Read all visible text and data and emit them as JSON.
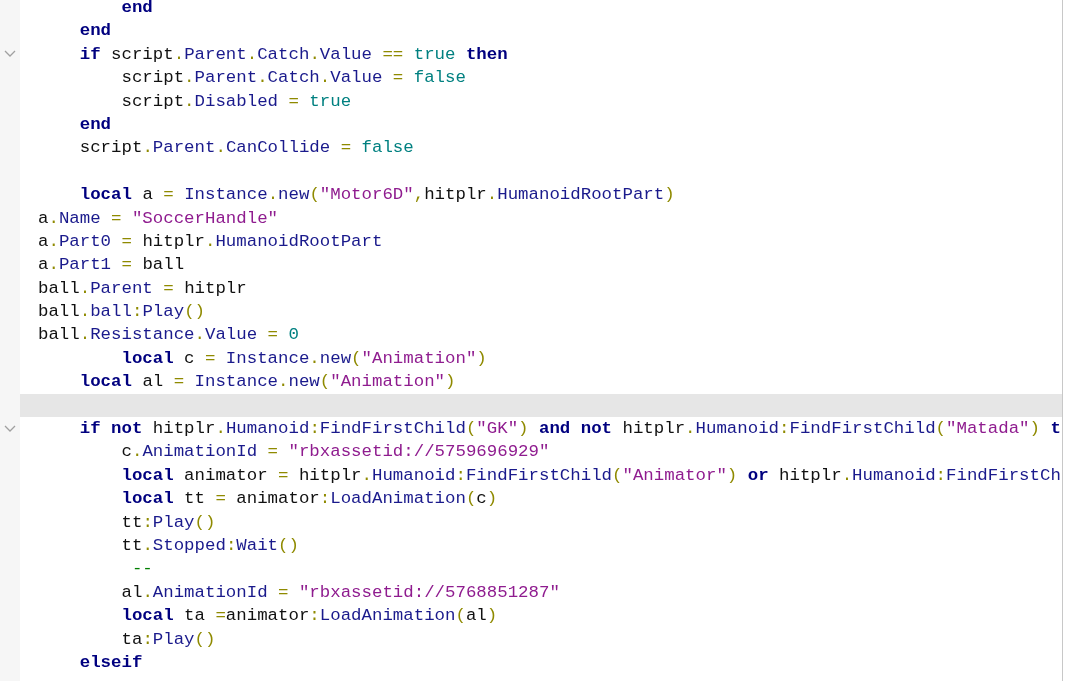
{
  "editor": {
    "lines": [
      {
        "fold_marker": false,
        "current": false,
        "tokens": [
          {
            "kind": "kw",
            "text": "        end"
          }
        ]
      },
      {
        "fold_marker": false,
        "current": false,
        "tokens": [
          {
            "kind": "kw",
            "text": "    end"
          }
        ]
      },
      {
        "fold_marker": true,
        "current": false,
        "tokens": [
          {
            "kind": "kw",
            "text": "    if "
          },
          {
            "kind": "id",
            "text": "script"
          },
          {
            "kind": "op",
            "text": "."
          },
          {
            "kind": "prop",
            "text": "Parent"
          },
          {
            "kind": "op",
            "text": "."
          },
          {
            "kind": "prop",
            "text": "Catch"
          },
          {
            "kind": "op",
            "text": "."
          },
          {
            "kind": "prop",
            "text": "Value"
          },
          {
            "kind": "op",
            "text": " == "
          },
          {
            "kind": "lit",
            "text": "true"
          },
          {
            "kind": "kw",
            "text": " then"
          }
        ]
      },
      {
        "fold_marker": false,
        "current": false,
        "tokens": [
          {
            "kind": "id",
            "text": "        script"
          },
          {
            "kind": "op",
            "text": "."
          },
          {
            "kind": "prop",
            "text": "Parent"
          },
          {
            "kind": "op",
            "text": "."
          },
          {
            "kind": "prop",
            "text": "Catch"
          },
          {
            "kind": "op",
            "text": "."
          },
          {
            "kind": "prop",
            "text": "Value"
          },
          {
            "kind": "op",
            "text": " = "
          },
          {
            "kind": "lit",
            "text": "false"
          }
        ]
      },
      {
        "fold_marker": false,
        "current": false,
        "tokens": [
          {
            "kind": "id",
            "text": "        script"
          },
          {
            "kind": "op",
            "text": "."
          },
          {
            "kind": "prop",
            "text": "Disabled"
          },
          {
            "kind": "op",
            "text": " = "
          },
          {
            "kind": "lit",
            "text": "true"
          }
        ]
      },
      {
        "fold_marker": false,
        "current": false,
        "tokens": [
          {
            "kind": "kw",
            "text": "    end"
          }
        ]
      },
      {
        "fold_marker": false,
        "current": false,
        "tokens": [
          {
            "kind": "id",
            "text": "    script"
          },
          {
            "kind": "op",
            "text": "."
          },
          {
            "kind": "prop",
            "text": "Parent"
          },
          {
            "kind": "op",
            "text": "."
          },
          {
            "kind": "prop",
            "text": "CanCollide"
          },
          {
            "kind": "op",
            "text": " = "
          },
          {
            "kind": "lit",
            "text": "false"
          }
        ]
      },
      {
        "fold_marker": false,
        "current": false
      },
      {
        "fold_marker": false,
        "current": false,
        "tokens": [
          {
            "kind": "kw",
            "text": "    local "
          },
          {
            "kind": "id",
            "text": "a"
          },
          {
            "kind": "op",
            "text": " = "
          },
          {
            "kind": "prop",
            "text": "Instance"
          },
          {
            "kind": "op",
            "text": "."
          },
          {
            "kind": "prop",
            "text": "new"
          },
          {
            "kind": "op",
            "text": "("
          },
          {
            "kind": "str",
            "text": "\"Motor6D\""
          },
          {
            "kind": "op",
            "text": ","
          },
          {
            "kind": "id",
            "text": "hitplr"
          },
          {
            "kind": "op",
            "text": "."
          },
          {
            "kind": "prop",
            "text": "HumanoidRootPart"
          },
          {
            "kind": "op",
            "text": ")"
          }
        ]
      },
      {
        "fold_marker": false,
        "current": false,
        "tokens": [
          {
            "kind": "id",
            "text": "a"
          },
          {
            "kind": "op",
            "text": "."
          },
          {
            "kind": "prop",
            "text": "Name"
          },
          {
            "kind": "op",
            "text": " = "
          },
          {
            "kind": "str",
            "text": "\"SoccerHandle\""
          }
        ]
      },
      {
        "fold_marker": false,
        "current": false,
        "tokens": [
          {
            "kind": "id",
            "text": "a"
          },
          {
            "kind": "op",
            "text": "."
          },
          {
            "kind": "prop",
            "text": "Part0"
          },
          {
            "kind": "op",
            "text": " = "
          },
          {
            "kind": "id",
            "text": "hitplr"
          },
          {
            "kind": "op",
            "text": "."
          },
          {
            "kind": "prop",
            "text": "HumanoidRootPart"
          }
        ]
      },
      {
        "fold_marker": false,
        "current": false,
        "tokens": [
          {
            "kind": "id",
            "text": "a"
          },
          {
            "kind": "op",
            "text": "."
          },
          {
            "kind": "prop",
            "text": "Part1"
          },
          {
            "kind": "op",
            "text": " = "
          },
          {
            "kind": "id",
            "text": "ball"
          }
        ]
      },
      {
        "fold_marker": false,
        "current": false,
        "tokens": [
          {
            "kind": "id",
            "text": "ball"
          },
          {
            "kind": "op",
            "text": "."
          },
          {
            "kind": "prop",
            "text": "Parent"
          },
          {
            "kind": "op",
            "text": " = "
          },
          {
            "kind": "id",
            "text": "hitplr"
          }
        ]
      },
      {
        "fold_marker": false,
        "current": false,
        "tokens": [
          {
            "kind": "id",
            "text": "ball"
          },
          {
            "kind": "op",
            "text": "."
          },
          {
            "kind": "prop",
            "text": "ball"
          },
          {
            "kind": "op",
            "text": ":"
          },
          {
            "kind": "prop",
            "text": "Play"
          },
          {
            "kind": "op",
            "text": "()"
          }
        ]
      },
      {
        "fold_marker": false,
        "current": false,
        "tokens": [
          {
            "kind": "id",
            "text": "ball"
          },
          {
            "kind": "op",
            "text": "."
          },
          {
            "kind": "prop",
            "text": "Resistance"
          },
          {
            "kind": "op",
            "text": "."
          },
          {
            "kind": "prop",
            "text": "Value"
          },
          {
            "kind": "op",
            "text": " = "
          },
          {
            "kind": "lit",
            "text": "0"
          }
        ]
      },
      {
        "fold_marker": false,
        "current": false,
        "tokens": [
          {
            "kind": "kw",
            "text": "        local "
          },
          {
            "kind": "id",
            "text": "c"
          },
          {
            "kind": "op",
            "text": " = "
          },
          {
            "kind": "prop",
            "text": "Instance"
          },
          {
            "kind": "op",
            "text": "."
          },
          {
            "kind": "prop",
            "text": "new"
          },
          {
            "kind": "op",
            "text": "("
          },
          {
            "kind": "str",
            "text": "\"Animation\""
          },
          {
            "kind": "op",
            "text": ")"
          }
        ]
      },
      {
        "fold_marker": false,
        "current": false,
        "tokens": [
          {
            "kind": "kw",
            "text": "    local "
          },
          {
            "kind": "id",
            "text": "al"
          },
          {
            "kind": "op",
            "text": " = "
          },
          {
            "kind": "prop",
            "text": "Instance"
          },
          {
            "kind": "op",
            "text": "."
          },
          {
            "kind": "prop",
            "text": "new"
          },
          {
            "kind": "op",
            "text": "("
          },
          {
            "kind": "str",
            "text": "\"Animation\""
          },
          {
            "kind": "op",
            "text": ")"
          }
        ]
      },
      {
        "fold_marker": false,
        "current": true
      },
      {
        "fold_marker": true,
        "current": false,
        "tokens": [
          {
            "kind": "kw",
            "text": "    if not "
          },
          {
            "kind": "id",
            "text": "hitplr"
          },
          {
            "kind": "op",
            "text": "."
          },
          {
            "kind": "prop",
            "text": "Humanoid"
          },
          {
            "kind": "op",
            "text": ":"
          },
          {
            "kind": "prop",
            "text": "FindFirstChild"
          },
          {
            "kind": "op",
            "text": "("
          },
          {
            "kind": "str",
            "text": "\"GK\""
          },
          {
            "kind": "op",
            "text": ")"
          },
          {
            "kind": "kw",
            "text": " and not "
          },
          {
            "kind": "id",
            "text": "hitplr"
          },
          {
            "kind": "op",
            "text": "."
          },
          {
            "kind": "prop",
            "text": "Humanoid"
          },
          {
            "kind": "op",
            "text": ":"
          },
          {
            "kind": "prop",
            "text": "FindFirstChild"
          },
          {
            "kind": "op",
            "text": "("
          },
          {
            "kind": "str",
            "text": "\"Matada\""
          },
          {
            "kind": "op",
            "text": ")"
          },
          {
            "kind": "kw",
            "text": " t"
          }
        ]
      },
      {
        "fold_marker": false,
        "current": false,
        "tokens": [
          {
            "kind": "id",
            "text": "        c"
          },
          {
            "kind": "op",
            "text": "."
          },
          {
            "kind": "prop",
            "text": "AnimationId"
          },
          {
            "kind": "op",
            "text": " = "
          },
          {
            "kind": "str",
            "text": "\"rbxassetid://5759696929\""
          }
        ]
      },
      {
        "fold_marker": false,
        "current": false,
        "tokens": [
          {
            "kind": "kw",
            "text": "        local "
          },
          {
            "kind": "id",
            "text": "animator"
          },
          {
            "kind": "op",
            "text": " = "
          },
          {
            "kind": "id",
            "text": "hitplr"
          },
          {
            "kind": "op",
            "text": "."
          },
          {
            "kind": "prop",
            "text": "Humanoid"
          },
          {
            "kind": "op",
            "text": ":"
          },
          {
            "kind": "prop",
            "text": "FindFirstChild"
          },
          {
            "kind": "op",
            "text": "("
          },
          {
            "kind": "str",
            "text": "\"Animator\""
          },
          {
            "kind": "op",
            "text": ")"
          },
          {
            "kind": "kw",
            "text": " or "
          },
          {
            "kind": "id",
            "text": "hitplr"
          },
          {
            "kind": "op",
            "text": "."
          },
          {
            "kind": "prop",
            "text": "Humanoid"
          },
          {
            "kind": "op",
            "text": ":"
          },
          {
            "kind": "prop",
            "text": "FindFirstCh"
          }
        ]
      },
      {
        "fold_marker": false,
        "current": false,
        "tokens": [
          {
            "kind": "kw",
            "text": "        local "
          },
          {
            "kind": "id",
            "text": "tt"
          },
          {
            "kind": "op",
            "text": " = "
          },
          {
            "kind": "id",
            "text": "animator"
          },
          {
            "kind": "op",
            "text": ":"
          },
          {
            "kind": "prop",
            "text": "LoadAnimation"
          },
          {
            "kind": "op",
            "text": "("
          },
          {
            "kind": "id",
            "text": "c"
          },
          {
            "kind": "op",
            "text": ")"
          }
        ]
      },
      {
        "fold_marker": false,
        "current": false,
        "tokens": [
          {
            "kind": "id",
            "text": "        tt"
          },
          {
            "kind": "op",
            "text": ":"
          },
          {
            "kind": "prop",
            "text": "Play"
          },
          {
            "kind": "op",
            "text": "()"
          }
        ]
      },
      {
        "fold_marker": false,
        "current": false,
        "tokens": [
          {
            "kind": "id",
            "text": "        tt"
          },
          {
            "kind": "op",
            "text": "."
          },
          {
            "kind": "prop",
            "text": "Stopped"
          },
          {
            "kind": "op",
            "text": ":"
          },
          {
            "kind": "prop",
            "text": "Wait"
          },
          {
            "kind": "op",
            "text": "()"
          }
        ]
      },
      {
        "fold_marker": false,
        "current": false,
        "tokens": [
          {
            "kind": "com",
            "text": "         --"
          }
        ]
      },
      {
        "fold_marker": false,
        "current": false,
        "tokens": [
          {
            "kind": "id",
            "text": "        al"
          },
          {
            "kind": "op",
            "text": "."
          },
          {
            "kind": "prop",
            "text": "AnimationId"
          },
          {
            "kind": "op",
            "text": " = "
          },
          {
            "kind": "str",
            "text": "\"rbxassetid://5768851287\""
          }
        ]
      },
      {
        "fold_marker": false,
        "current": false,
        "tokens": [
          {
            "kind": "kw",
            "text": "        local "
          },
          {
            "kind": "id",
            "text": "ta"
          },
          {
            "kind": "op",
            "text": " ="
          },
          {
            "kind": "id",
            "text": "animator"
          },
          {
            "kind": "op",
            "text": ":"
          },
          {
            "kind": "prop",
            "text": "LoadAnimation"
          },
          {
            "kind": "op",
            "text": "("
          },
          {
            "kind": "id",
            "text": "al"
          },
          {
            "kind": "op",
            "text": ")"
          }
        ]
      },
      {
        "fold_marker": false,
        "current": false,
        "tokens": [
          {
            "kind": "id",
            "text": "        ta"
          },
          {
            "kind": "op",
            "text": ":"
          },
          {
            "kind": "prop",
            "text": "Play"
          },
          {
            "kind": "op",
            "text": "()"
          }
        ]
      },
      {
        "fold_marker": false,
        "current": false,
        "tokens": [
          {
            "kind": "kw",
            "text": "    elseif"
          }
        ]
      }
    ]
  }
}
